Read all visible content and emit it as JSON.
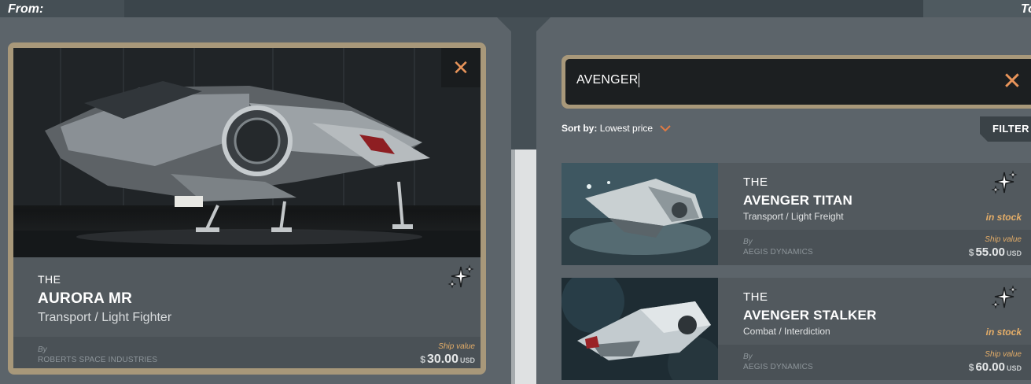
{
  "header": {
    "from_label": "From:",
    "to_label": "To"
  },
  "selected": {
    "the": "THE",
    "name": "AURORA MR",
    "role": "Transport / Light Fighter",
    "by_label": "By",
    "manufacturer": "ROBERTS SPACE INDUSTRIES",
    "ship_value_label": "Ship value",
    "currency_symbol": "$",
    "price": "30.00",
    "currency": "USD",
    "close_icon": "✕"
  },
  "search": {
    "value": "AVENGER",
    "clear_icon": "✕"
  },
  "sort": {
    "label": "Sort by:",
    "value": "Lowest price"
  },
  "filter_label": "FILTER",
  "results": [
    {
      "the": "THE",
      "name": "AVENGER TITAN",
      "role": "Transport / Light Freight",
      "stock": "in stock",
      "by_label": "By",
      "manufacturer": "AEGIS DYNAMICS",
      "ship_value_label": "Ship value",
      "currency_symbol": "$",
      "price": "55.00",
      "currency": "USD"
    },
    {
      "the": "THE",
      "name": "AVENGER STALKER",
      "role": "Combat / Interdiction",
      "stock": "in stock",
      "by_label": "By",
      "manufacturer": "AEGIS DYNAMICS",
      "ship_value_label": "Ship value",
      "currency_symbol": "$",
      "price": "60.00",
      "currency": "USD"
    }
  ],
  "colors": {
    "accent_orange": "#e8945a",
    "gold_border": "#a8987a",
    "panel": "#5c646a",
    "stock_text": "#e4ad68"
  }
}
